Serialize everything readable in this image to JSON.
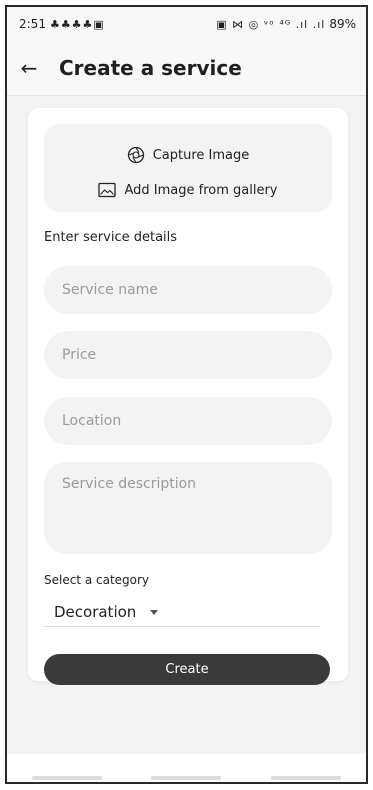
{
  "status_bar": {
    "time": "2:51",
    "left_icons": "♣♣♣♣▣",
    "right_icons": "▣ ⋈ ◎ ᵛᵒ ⁴ᴳ .ıl .ıl",
    "battery": "89%"
  },
  "app_bar": {
    "back_icon": "←",
    "title": "Create a service"
  },
  "image_picker": {
    "capture_label": "Capture Image",
    "gallery_label": "Add Image from gallery"
  },
  "form": {
    "section_label": "Enter service details",
    "service_name_placeholder": "Service name",
    "price_placeholder": "Price",
    "location_placeholder": "Location",
    "description_placeholder": "Service description",
    "category_label": "Select a category",
    "category_value": "Decoration",
    "create_label": "Create"
  },
  "colors": {
    "accent": "#3a3a3a",
    "field_bg": "#f3f3f3"
  }
}
